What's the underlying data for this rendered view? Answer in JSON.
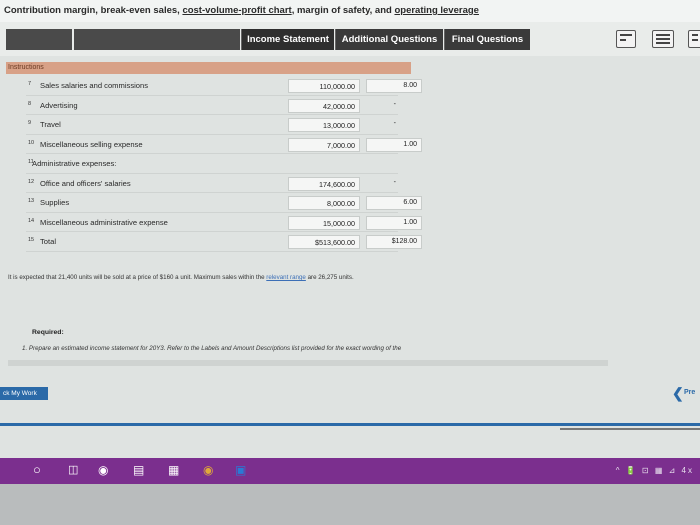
{
  "page_title": {
    "part1": "Contribution margin, break-even sales, ",
    "part2": "cost-volume-profit chart",
    "part3": ", margin of safety, and ",
    "part4": "operating leverage"
  },
  "tabs": [
    {
      "label": "Income Statement"
    },
    {
      "label": "Additional Questions"
    },
    {
      "label": "Final Questions"
    }
  ],
  "instructions_label": "Instructions",
  "rows": [
    {
      "num": "7",
      "label": "Sales salaries and commissions",
      "amount": "110,000.00",
      "unit": "8.00",
      "amount_box": true,
      "unit_box": true
    },
    {
      "num": "8",
      "label": "Advertising",
      "amount": "42,000.00",
      "unit": "-",
      "amount_box": true,
      "unit_box": false
    },
    {
      "num": "9",
      "label": "Travel",
      "amount": "13,000.00",
      "unit": "-",
      "amount_box": true,
      "unit_box": false
    },
    {
      "num": "10",
      "label": "Miscellaneous selling expense",
      "amount": "7,000.00",
      "unit": "1.00",
      "amount_box": true,
      "unit_box": true
    },
    {
      "num": "11",
      "label": "Administrative expenses:",
      "amount": "",
      "unit": "",
      "amount_box": false,
      "unit_box": false
    },
    {
      "num": "12",
      "label": "Office and officers' salaries",
      "amount": "174,600.00",
      "unit": "-",
      "amount_box": true,
      "unit_box": false
    },
    {
      "num": "13",
      "label": "Supplies",
      "amount": "8,000.00",
      "unit": "6.00",
      "amount_box": true,
      "unit_box": true
    },
    {
      "num": "14",
      "label": "Miscellaneous administrative expense",
      "amount": "15,000.00",
      "unit": "1.00",
      "amount_box": true,
      "unit_box": true
    },
    {
      "num": "15",
      "label": "Total",
      "amount": "$513,600.00",
      "unit": "$128.00",
      "amount_box": true,
      "unit_box": true
    }
  ],
  "paragraph": {
    "before": "It is expected that 21,400 units will be sold at a price of $160 a unit. Maximum sales within the ",
    "link": "relevant range",
    "after": " are 26,275 units."
  },
  "required_label": "Required:",
  "required_item": "1. Prepare an estimated income statement for 20Y3. Refer to the Labels and Amount Descriptions list provided for the exact wording of the",
  "check_button": "ck My Work",
  "prev_label": "Pre",
  "taskbar_tray": "^ 🔋 ⊡ ▦ ⊿ 4x"
}
